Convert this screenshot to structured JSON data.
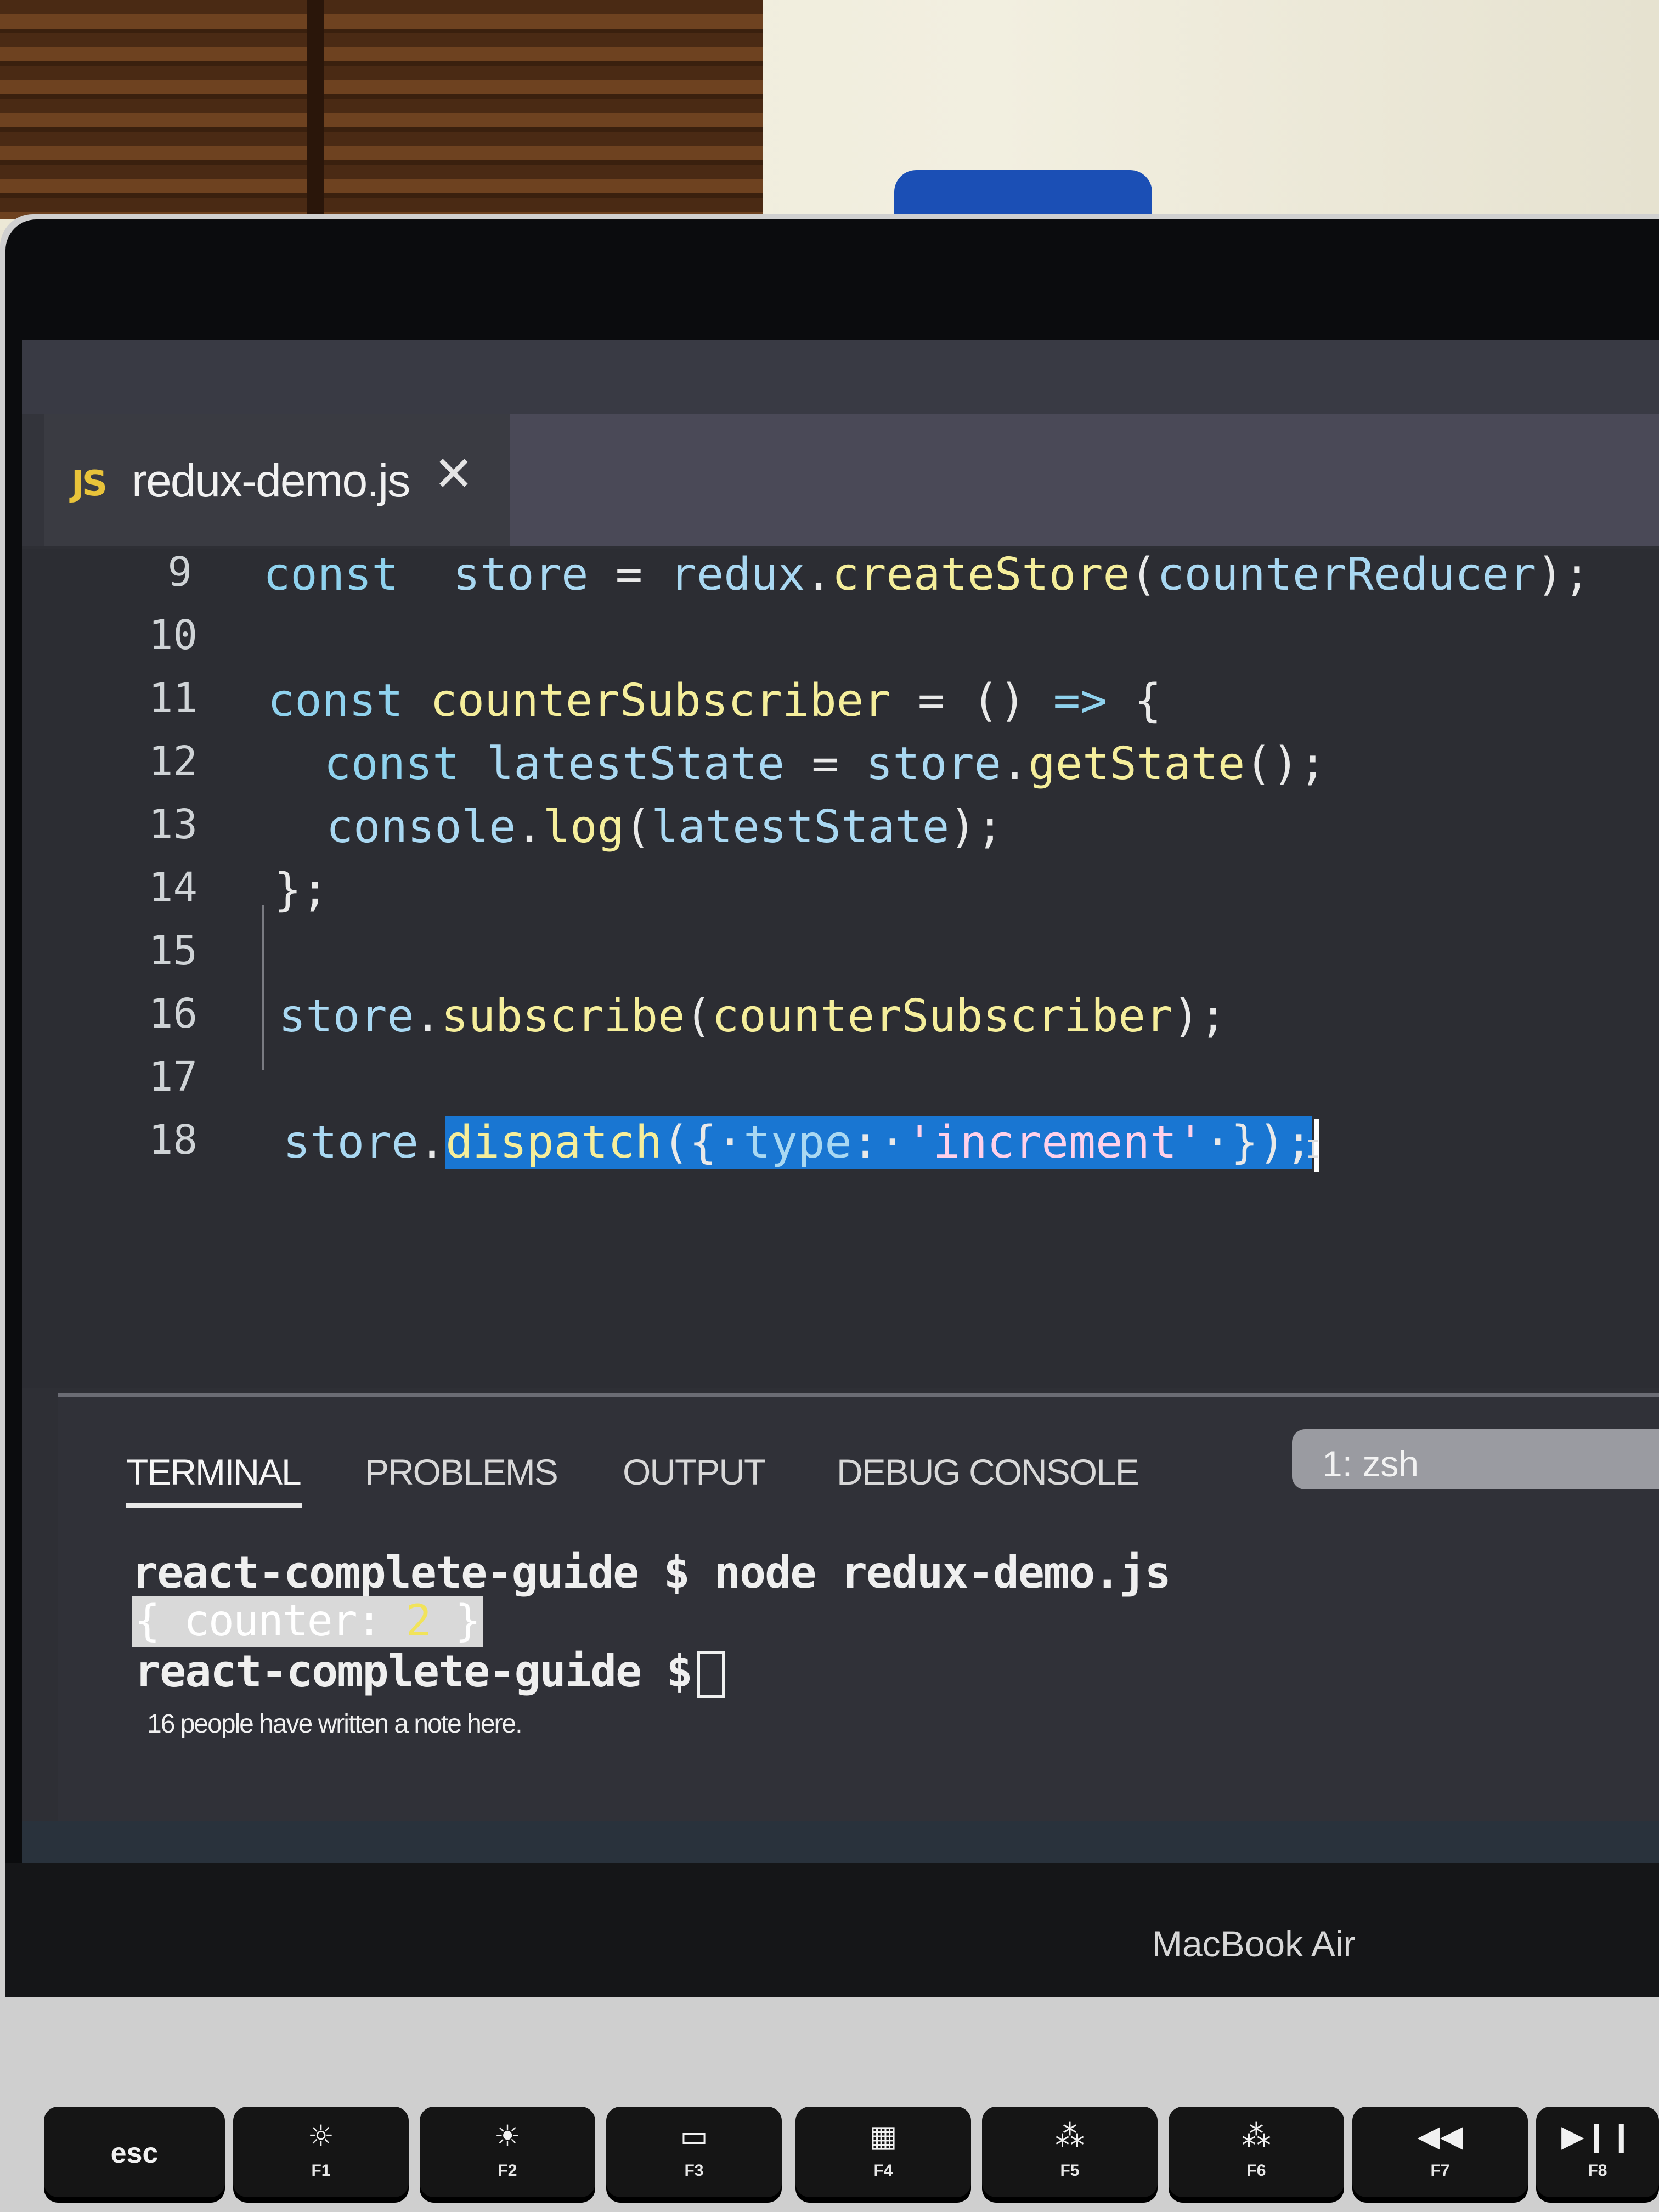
{
  "editor": {
    "tab": {
      "language_badge": "JS",
      "filename": "redux-demo.js",
      "close_glyph": "✕"
    },
    "lines": [
      {
        "number": "9",
        "parts": [
          [
            "kw",
            "const"
          ],
          [
            "",
            "  "
          ],
          [
            "var",
            "store"
          ],
          [
            "punc",
            " = "
          ],
          [
            "var",
            "redux"
          ],
          [
            "punc",
            "."
          ],
          [
            "fn",
            "createStore"
          ],
          [
            "punc",
            "("
          ],
          [
            "var",
            "counterReducer"
          ],
          [
            "punc",
            ");"
          ]
        ]
      },
      {
        "number": "10",
        "parts": []
      },
      {
        "number": "11",
        "parts": [
          [
            "kw",
            "const"
          ],
          [
            "punc",
            " "
          ],
          [
            "fn",
            "counterSubscriber"
          ],
          [
            "punc",
            " = () "
          ],
          [
            "kw",
            "=>"
          ],
          [
            "punc",
            " {"
          ]
        ]
      },
      {
        "number": "12",
        "parts": [
          [
            "punc",
            "  "
          ],
          [
            "kw",
            "const"
          ],
          [
            "punc",
            " "
          ],
          [
            "var",
            "latestState"
          ],
          [
            "punc",
            " = "
          ],
          [
            "var",
            "store"
          ],
          [
            "punc",
            "."
          ],
          [
            "fn",
            "getState"
          ],
          [
            "punc",
            "();"
          ]
        ]
      },
      {
        "number": "13",
        "parts": [
          [
            "punc",
            "  "
          ],
          [
            "var",
            "console"
          ],
          [
            "punc",
            "."
          ],
          [
            "fn",
            "log"
          ],
          [
            "punc",
            "("
          ],
          [
            "var",
            "latestState"
          ],
          [
            "punc",
            ");"
          ]
        ]
      },
      {
        "number": "14",
        "parts": [
          [
            "punc",
            "};"
          ]
        ]
      },
      {
        "number": "15",
        "parts": []
      },
      {
        "number": "16",
        "parts": [
          [
            "var",
            "store"
          ],
          [
            "punc",
            "."
          ],
          [
            "fn",
            "subscribe"
          ],
          [
            "punc",
            "("
          ],
          [
            "fn",
            "counterSubscriber"
          ],
          [
            "punc",
            ");"
          ]
        ]
      },
      {
        "number": "17",
        "parts": []
      },
      {
        "number": "18",
        "parts": [
          [
            "var",
            "store"
          ],
          [
            "punc",
            "."
          ]
        ],
        "selected": [
          [
            "fn",
            "dispatch"
          ],
          [
            "punc",
            "({·"
          ],
          [
            "var",
            "type"
          ],
          [
            "punc",
            ":·"
          ],
          [
            "str",
            "'increment'"
          ],
          [
            "punc",
            "·});"
          ]
        ]
      }
    ]
  },
  "panel": {
    "tabs": [
      "TERMINAL",
      "PROBLEMS",
      "OUTPUT",
      "DEBUG CONSOLE"
    ],
    "active_tab": "TERMINAL",
    "terminal_select": "1: zsh"
  },
  "terminal": {
    "prompt_1": "react-complete-guide $ node redux-demo.js",
    "output_prefix": "{ counter: ",
    "output_value": "2",
    "output_suffix": " }",
    "prompt_2": "react-complete-guide $",
    "note": "16 people have written a note here."
  },
  "device": {
    "brand": "MacBook Air",
    "keys": [
      {
        "label": "esc",
        "icon": "",
        "fn": ""
      },
      {
        "label": "",
        "icon": "☼",
        "fn": "F1",
        "icon_name": "brightness-down-icon"
      },
      {
        "label": "",
        "icon": "☀",
        "fn": "F2",
        "icon_name": "brightness-up-icon"
      },
      {
        "label": "",
        "icon": "▭",
        "fn": "F3",
        "icon_name": "mission-control-icon"
      },
      {
        "label": "",
        "icon": "▦",
        "fn": "F4",
        "icon_name": "launchpad-icon"
      },
      {
        "label": "",
        "icon": "⁂",
        "fn": "F5",
        "icon_name": "keyboard-light-down-icon"
      },
      {
        "label": "",
        "icon": "⁂",
        "fn": "F6",
        "icon_name": "keyboard-light-up-icon"
      },
      {
        "label": "",
        "icon": "◀◀",
        "fn": "F7",
        "icon_name": "rewind-icon"
      },
      {
        "label": "",
        "icon": "▶❙❙",
        "fn": "F8",
        "icon_name": "play-pause-icon"
      }
    ]
  }
}
